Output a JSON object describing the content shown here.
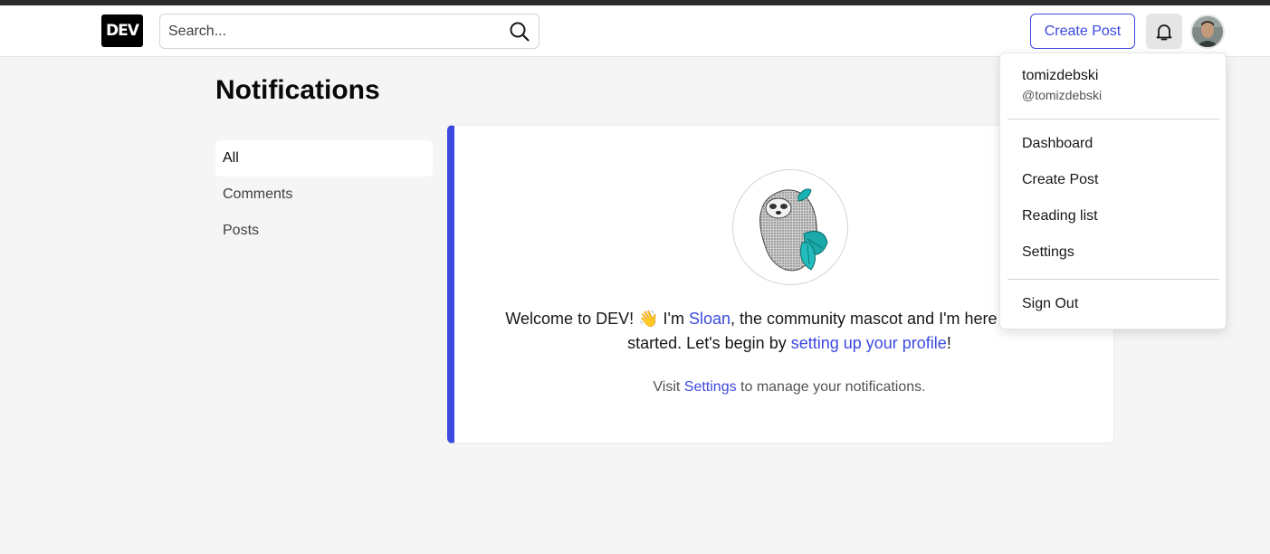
{
  "header": {
    "logo_text": "DEV",
    "search_placeholder": "Search...",
    "create_post_label": "Create Post",
    "accent_color": "#3b49df"
  },
  "page": {
    "title": "Notifications"
  },
  "sidebar": {
    "items": [
      {
        "label": "All",
        "active": true
      },
      {
        "label": "Comments",
        "active": false
      },
      {
        "label": "Posts",
        "active": false
      }
    ]
  },
  "card": {
    "welcome_pre": "Welcome to DEV! 👋 I'm ",
    "sloan_link": "Sloan",
    "welcome_mid": ", the community mascot and I'm here to get you started. Let's begin by ",
    "profile_link": "setting up your profile",
    "welcome_end": "!",
    "visit_pre": "Visit ",
    "settings_link": "Settings",
    "visit_post": " to manage your notifications."
  },
  "dropdown": {
    "name": "tomizdebski",
    "handle": "@tomizdebski",
    "items": [
      "Dashboard",
      "Create Post",
      "Reading list",
      "Settings"
    ],
    "sign_out": "Sign Out"
  },
  "icons": {
    "search": "search-icon",
    "bell": "bell-icon",
    "avatar": "user-avatar",
    "mascot": "sloan-sloth-mascot"
  }
}
